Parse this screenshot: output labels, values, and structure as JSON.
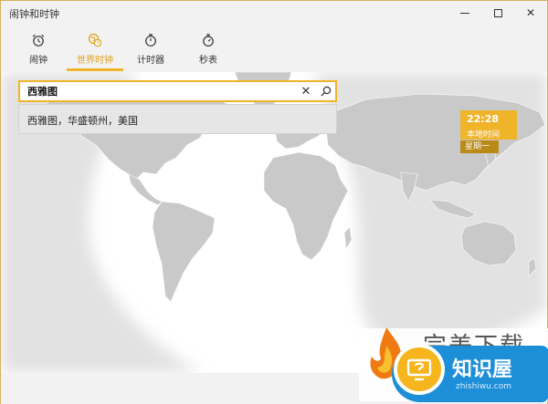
{
  "window": {
    "title": "闹钟和时钟",
    "minimize_icon": "minimize-icon",
    "maximize_icon": "maximize-icon",
    "close_glyph": "✕"
  },
  "tabs": [
    {
      "label": "闹钟",
      "icon": "alarm-clock-icon",
      "active": false
    },
    {
      "label": "世界时钟",
      "icon": "world-clock-icon",
      "active": true
    },
    {
      "label": "计时器",
      "icon": "timer-icon",
      "active": false
    },
    {
      "label": "秒表",
      "icon": "stopwatch-icon",
      "active": false
    }
  ],
  "search": {
    "value": "西雅图",
    "placeholder": "",
    "clear_glyph": "✕",
    "suggestions": [
      "西雅图，华盛顿州，美国"
    ]
  },
  "clock": {
    "time": "22:28",
    "label": "本地时间",
    "day": "星期一"
  },
  "watermark": {
    "brand1": "完美下载",
    "brand2": "知识屋",
    "url": "zhishiwu.com"
  },
  "colors": {
    "accent": "#f0b42a",
    "accent_dark": "#b98a18",
    "land": "#c9c9c9",
    "night": "#e3e3e3"
  }
}
